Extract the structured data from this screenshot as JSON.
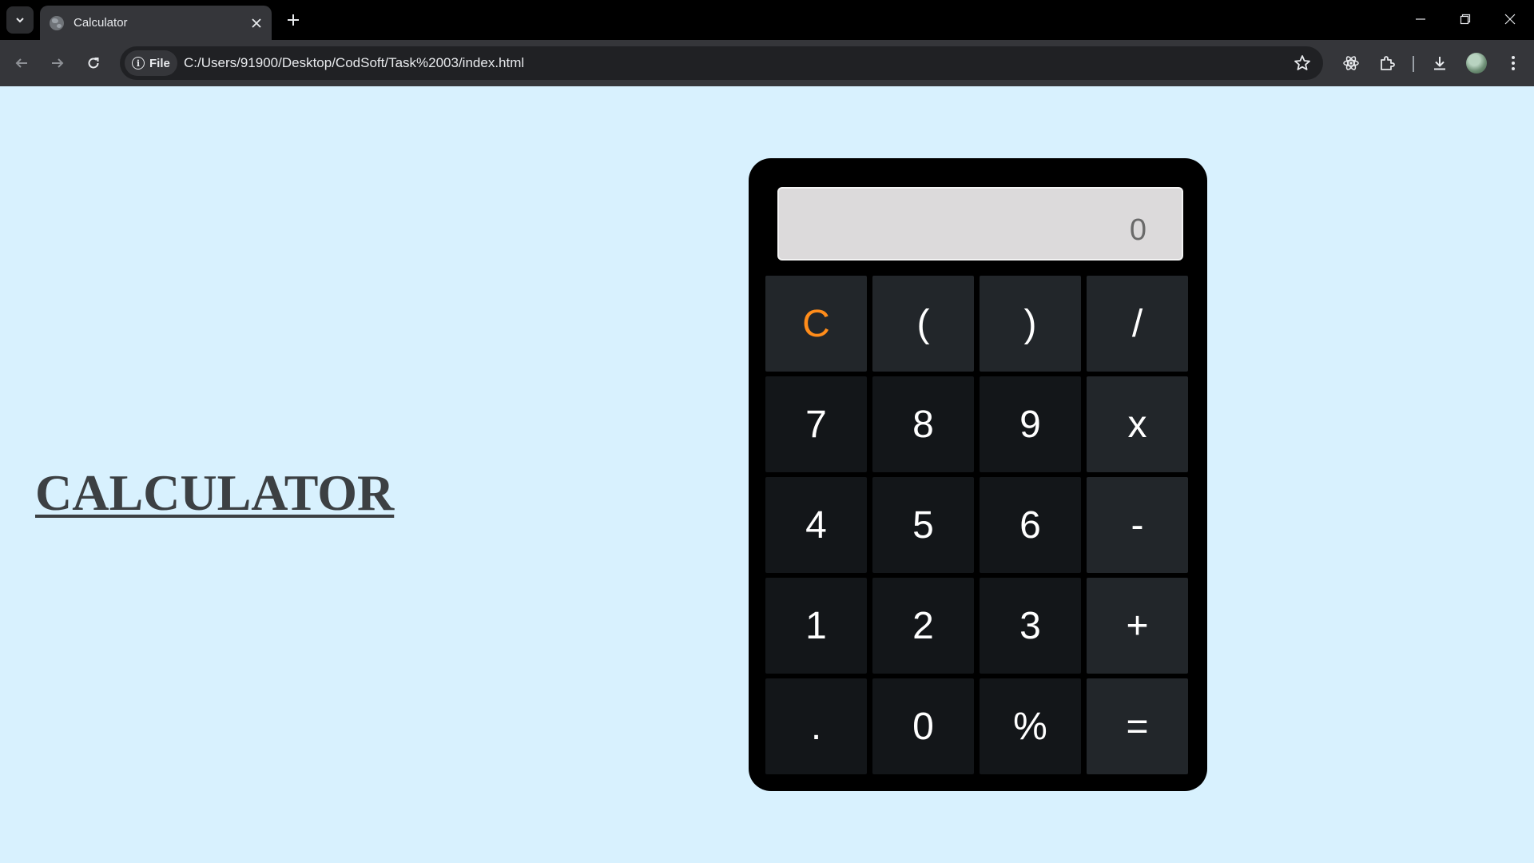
{
  "browser": {
    "tab_title": "Calculator",
    "site_chip_label": "File",
    "url": "C:/Users/91900/Desktop/CodSoft/Task%2003/index.html"
  },
  "page": {
    "heading": "CALCULATOR"
  },
  "calculator": {
    "display_value": "0",
    "keys": [
      "C",
      "(",
      ")",
      "/",
      "7",
      "8",
      "9",
      "x",
      "4",
      "5",
      "6",
      "-",
      "1",
      "2",
      "3",
      "+",
      ".",
      "0",
      "%",
      "="
    ]
  },
  "colors": {
    "page_background": "#d8f1fe",
    "calculator_body": "#000000",
    "digit_key": "#131619",
    "function_key": "#22262a",
    "clear_key_text": "#ff8c1a",
    "display_background": "#dcdadb"
  }
}
